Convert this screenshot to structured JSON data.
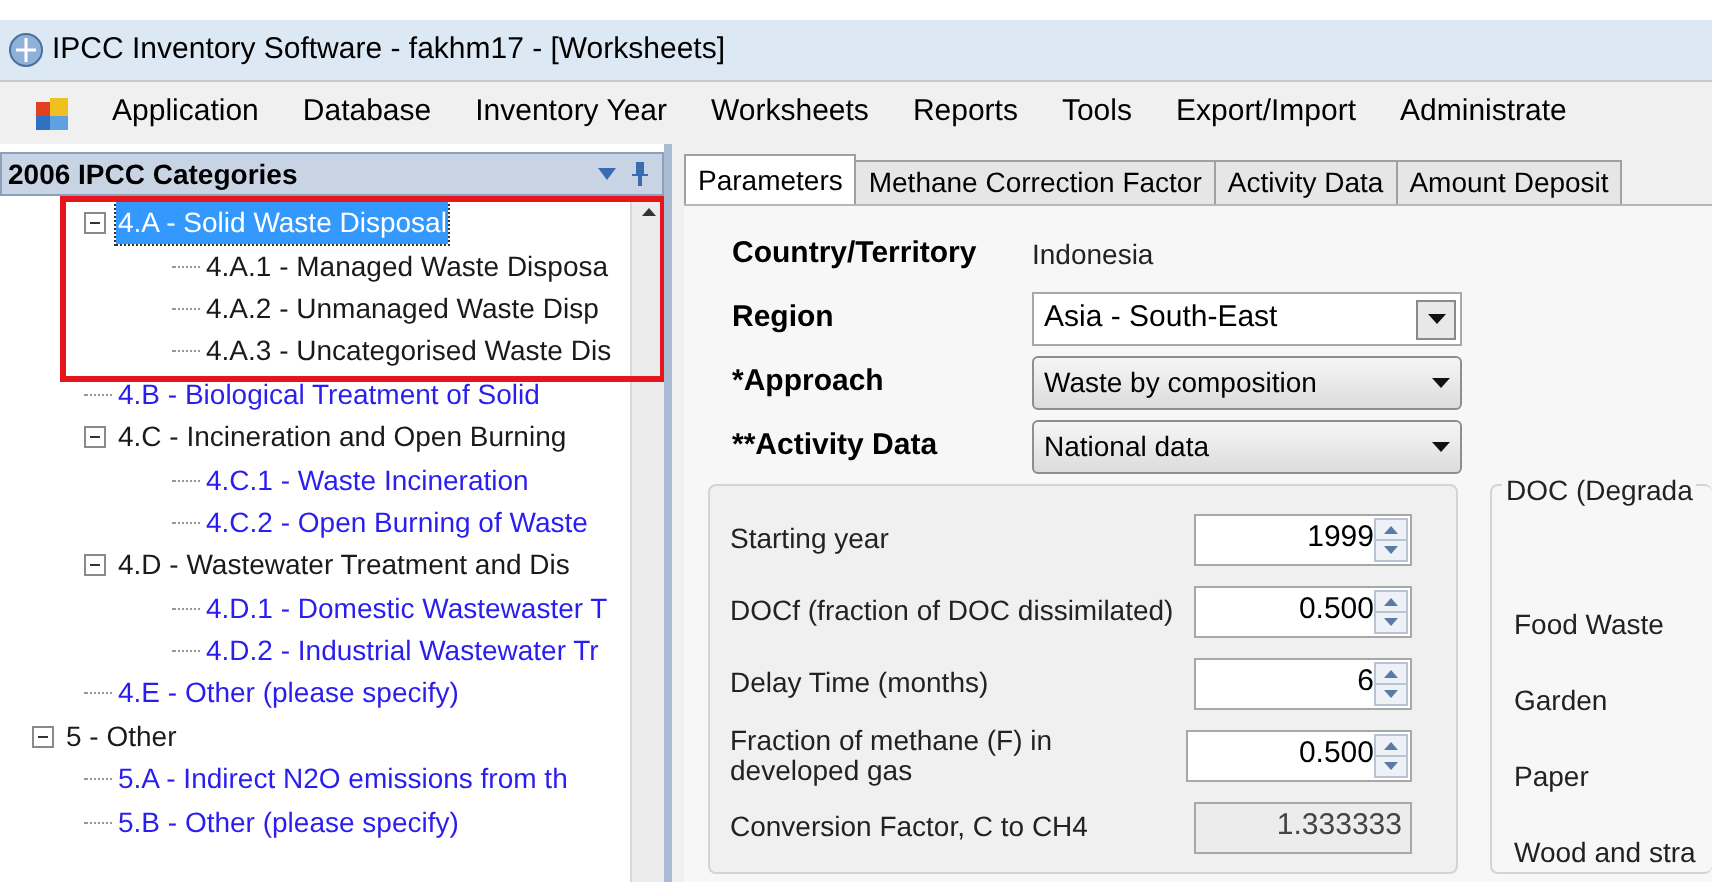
{
  "window": {
    "title": "IPCC Inventory Software - fakhm17 - [Worksheets]"
  },
  "menu": [
    "Application",
    "Database",
    "Inventory Year",
    "Worksheets",
    "Reports",
    "Tools",
    "Export/Import",
    "Administrate"
  ],
  "panel": {
    "title": "2006 IPCC Categories"
  },
  "tree": [
    {
      "children": [
        {
          "label": "4.A - Solid Waste Disposal",
          "selected": true,
          "linked": false,
          "expanded": true,
          "children": [
            {
              "label": "4.A.1 - Managed Waste Disposa",
              "selected": false,
              "linked": false
            },
            {
              "label": "4.A.2 - Unmanaged Waste Disp",
              "selected": false,
              "linked": false
            },
            {
              "label": "4.A.3 - Uncategorised Waste Dis",
              "selected": false,
              "linked": false
            }
          ]
        },
        {
          "label": "4.B - Biological Treatment of Solid",
          "selected": false,
          "linked": true
        },
        {
          "label": "4.C - Incineration and Open Burning",
          "selected": false,
          "linked": false,
          "expanded": true,
          "children": [
            {
              "label": "4.C.1 - Waste Incineration",
              "selected": false,
              "linked": true
            },
            {
              "label": "4.C.2 - Open Burning of Waste",
              "selected": false,
              "linked": true
            }
          ]
        },
        {
          "label": "4.D - Wastewater Treatment and Dis",
          "selected": false,
          "linked": false,
          "expanded": true,
          "children": [
            {
              "label": "4.D.1 - Domestic Wastewaster T",
              "selected": false,
              "linked": true
            },
            {
              "label": "4.D.2 - Industrial Wastewater Tr",
              "selected": false,
              "linked": true
            }
          ]
        },
        {
          "label": "4.E - Other (please specify)",
          "selected": false,
          "linked": true
        }
      ]
    },
    {
      "label": "5 - Other",
      "selected": false,
      "linked": false,
      "expanded": true,
      "children": [
        {
          "label": "5.A - Indirect N2O emissions from th",
          "selected": false,
          "linked": true
        },
        {
          "label": "5.B - Other (please specify)",
          "selected": false,
          "linked": true
        }
      ]
    }
  ],
  "tabs": [
    {
      "label": "Parameters",
      "selected": true
    },
    {
      "label": "Methane Correction Factor",
      "selected": false
    },
    {
      "label": "Activity Data",
      "selected": false
    },
    {
      "label": "Amount Deposit",
      "selected": false
    }
  ],
  "header_fields": [
    {
      "kind": "text",
      "label": "Country/Territory",
      "value": "Indonesia"
    },
    {
      "kind": "combo",
      "label": "Region",
      "value": "Asia - South-East"
    },
    {
      "kind": "dropdown",
      "label": "*Approach",
      "value": "Waste by composition"
    },
    {
      "kind": "dropdown",
      "label": "**Activity Data",
      "value": "National data"
    }
  ],
  "parameters": [
    {
      "label": "Starting year",
      "value": "1999",
      "disabled": false
    },
    {
      "label": "DOCf (fraction of DOC dissimilated)",
      "value": "0.500",
      "disabled": false
    },
    {
      "label": "Delay Time (months)",
      "value": "6",
      "disabled": false
    },
    {
      "label": "Fraction of methane (F) in developed gas",
      "value": "0.500",
      "disabled": false
    },
    {
      "label": "Conversion Factor, C to CH4",
      "value": "1.333333",
      "disabled": true
    }
  ],
  "doc_group": {
    "title": "DOC (Degrada",
    "items": [
      "Food Waste",
      "Garden",
      "Paper",
      "Wood and stra"
    ]
  }
}
